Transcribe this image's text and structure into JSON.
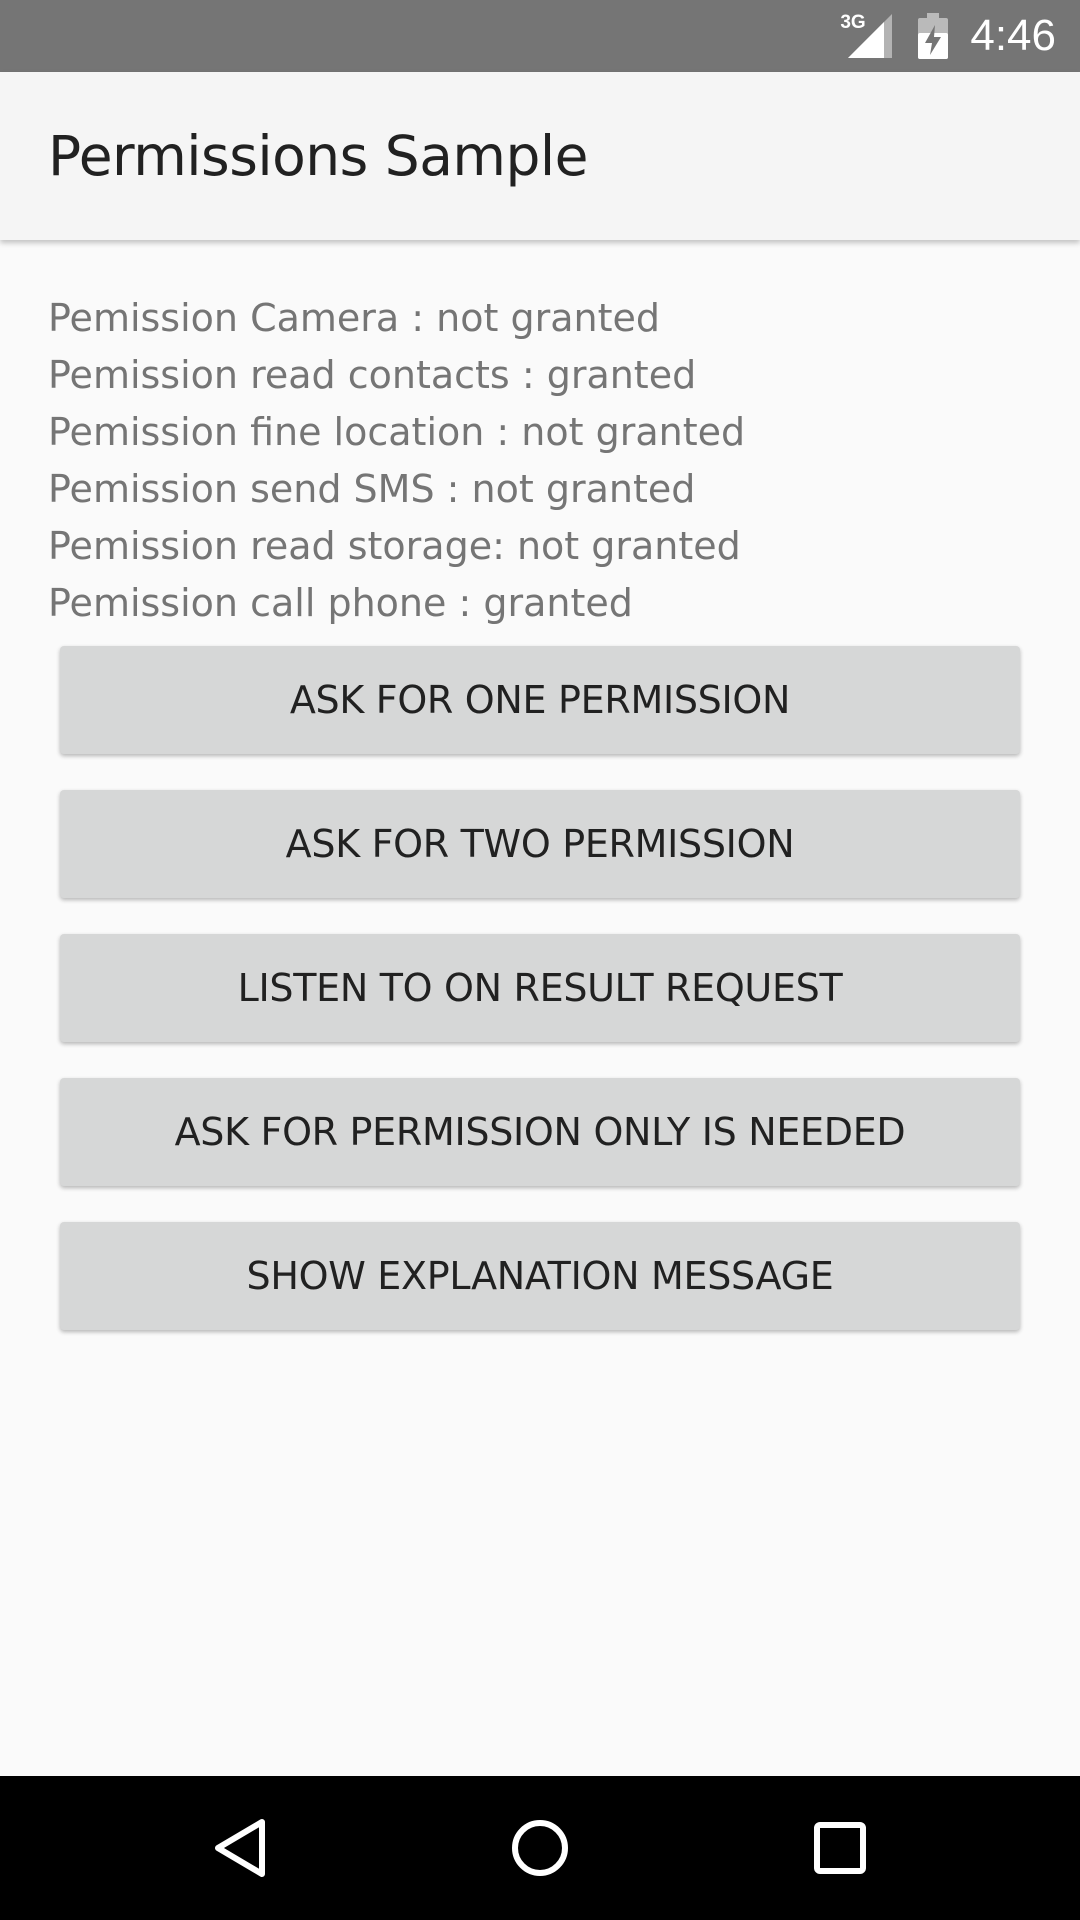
{
  "status_bar": {
    "network_type": "3G",
    "time": "4:46",
    "icons": [
      "signal-icon",
      "battery-charging-icon"
    ]
  },
  "app_bar": {
    "title": "Permissions Sample"
  },
  "permissions": [
    "Pemission Camera : not granted",
    "Pemission read contacts : granted",
    "Pemission fine location : not granted",
    "Pemission send SMS : not granted",
    "Pemission read storage: not granted",
    "Pemission call phone : granted"
  ],
  "buttons": [
    "ASK FOR ONE PERMISSION",
    "ASK FOR TWO PERMISSION",
    "LISTEN TO ON RESULT REQUEST",
    "ASK FOR PERMISSION ONLY IS NEEDED",
    "SHOW EXPLANATION MESSAGE"
  ],
  "nav_bar": {
    "icons": [
      "back-icon",
      "home-icon",
      "recents-icon"
    ]
  },
  "colors": {
    "status_bar": "#757575",
    "app_bar": "#f5f5f5",
    "background": "#fafafa",
    "button": "#d6d7d7",
    "permission_text": "#757575",
    "nav_bar": "#000000"
  }
}
